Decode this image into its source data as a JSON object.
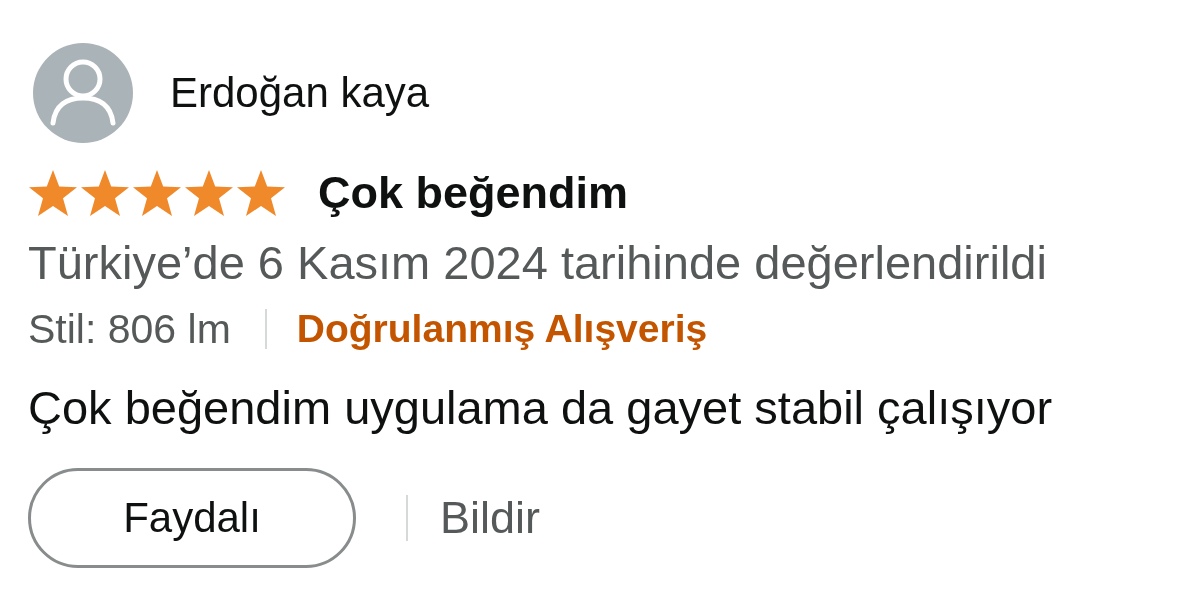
{
  "review": {
    "reviewer": {
      "name": "Erdoğan kaya"
    },
    "stars": 5,
    "title": "Çok beğendim",
    "date_line": "Türkiye’de 6 Kasım 2024 tarihinde değerlendirildi",
    "style": "Stil: 806 lm",
    "verified": "Doğrulanmış Alışveriş",
    "body": "Çok beğendim uygulama da gayet stabil çalışıyor",
    "actions": {
      "helpful_button": "Faydalı",
      "report_link": "Bildir"
    }
  }
}
